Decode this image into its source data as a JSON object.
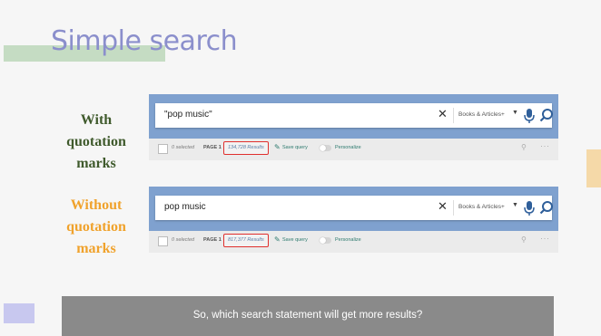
{
  "slide": {
    "title": "Simple search",
    "question": "So, which search statement will get more results?"
  },
  "examples": [
    {
      "label_line1": "With",
      "label_line2": "quotation marks",
      "query": "\"pop music\"",
      "scope": "Books & Articles+",
      "selected": "0 selected",
      "page": "PAGE 1",
      "results": "134,728 Results",
      "save_query": "Save query",
      "personalize": "Personalize"
    },
    {
      "label_line1": "Without",
      "label_line2": "quotation marks",
      "query": "pop music",
      "scope": "Books & Articles+",
      "selected": "0 selected",
      "page": "PAGE 1",
      "results": "817,377 Results",
      "save_query": "Save query",
      "personalize": "Personalize"
    }
  ],
  "icons": {
    "clear": "close-icon",
    "dropdown": "chevron-down-icon",
    "mic": "microphone-icon",
    "search": "search-icon",
    "save": "pin-icon",
    "pin_toolbar": "pushpin-icon",
    "more": "ellipsis-icon"
  },
  "colors": {
    "title": "#8b8fcc",
    "label_with": "#3f5a2c",
    "label_without": "#f0a22c",
    "panel": "#7fa1cf",
    "highlight": "#e0302e",
    "bottom_bar": "#8a8a8a"
  }
}
